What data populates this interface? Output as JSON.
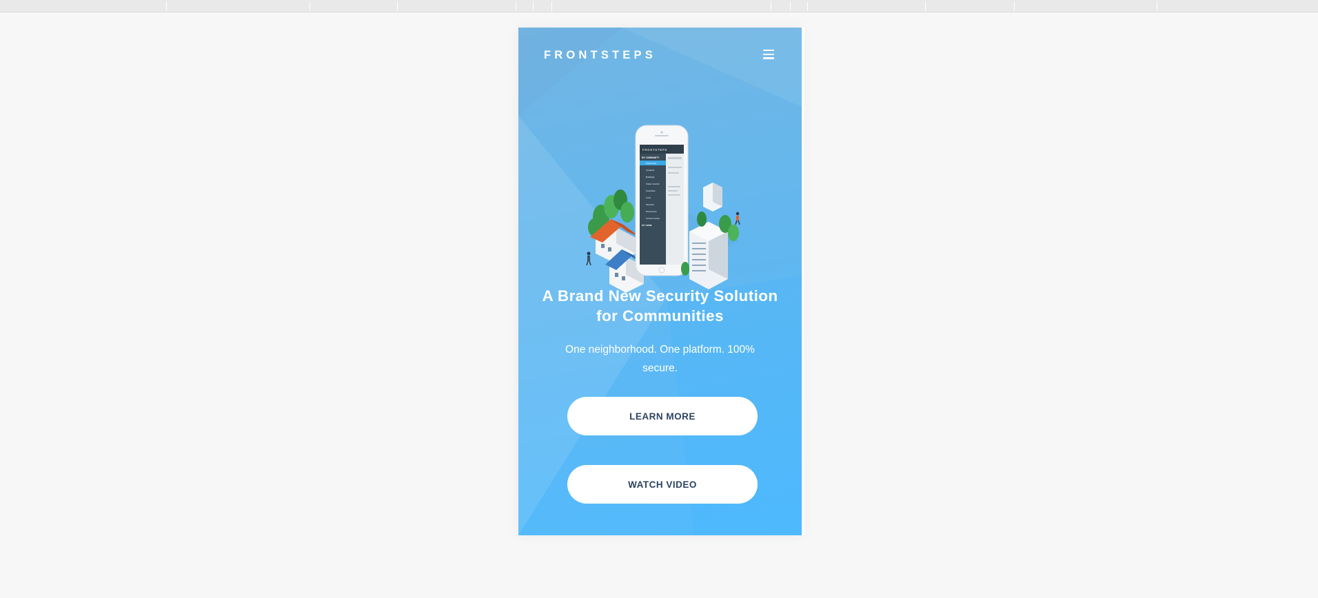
{
  "site": {
    "logo_text": "FRONTSTEPS",
    "menu_icon": "hamburger-menu-icon"
  },
  "hero": {
    "headline": "A Brand New Security Solution for Communities",
    "subheadline": "One neighborhood. One platform. 100% secure.",
    "illustration": "isometric-neighborhood-with-phone-illustration"
  },
  "phone_screen": {
    "app_logo": "FRONTSTEPS",
    "nav_heading": "MY COMMUNITY",
    "nav_items": [
      "Dashboard",
      "Contacts",
      "Buildings",
      "Visitor Control",
      "Amenities",
      "Units",
      "Services",
      "Documents",
      "Control Center"
    ],
    "section_heading": "MY HOME"
  },
  "actions": {
    "learn_more": "LEARN MORE",
    "watch_video": "WATCH VIDEO"
  },
  "colors": {
    "hero_top": "#72b6e3",
    "hero_bottom": "#52bafd",
    "button_bg": "#ffffff",
    "button_text": "#2c4360",
    "app_dark": "#2f3f4b",
    "app_highlight": "#3aa9e6",
    "roof_orange": "#e2642d",
    "roof_blue": "#3d7fc6",
    "tree_green": "#3a9b4a"
  }
}
